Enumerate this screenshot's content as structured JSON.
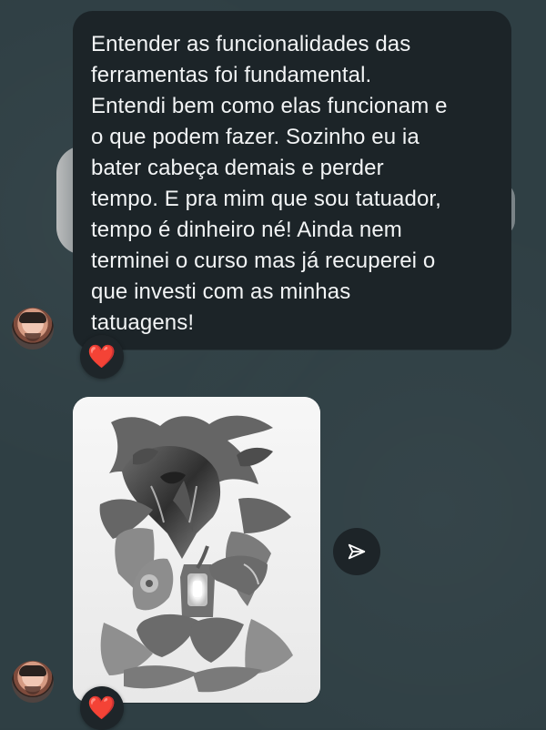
{
  "chat": {
    "message_1": {
      "text": "Entender as funcionalidades das\nferramentas foi fundamental.\nEntendi bem como elas funcionam e\no que podem fazer. Sozinho eu ia\nbater cabeça demais e perder\ntempo. E pra mim que sou tatuador,\ntempo é dinheiro né! Ainda nem\nterminei o curso mas já recuperei o\nque investi com as minhas\ntatuagens!",
      "reaction": "❤️"
    },
    "message_2": {
      "reaction": "❤️"
    }
  },
  "icons": {
    "share": "send-icon",
    "heart": "heart-icon",
    "avatar": "avatar"
  },
  "colors": {
    "background": "#2f3f44",
    "bubble": "#1c2428",
    "text": "#f2f4f5",
    "reaction_heart": "#ff3b30"
  }
}
